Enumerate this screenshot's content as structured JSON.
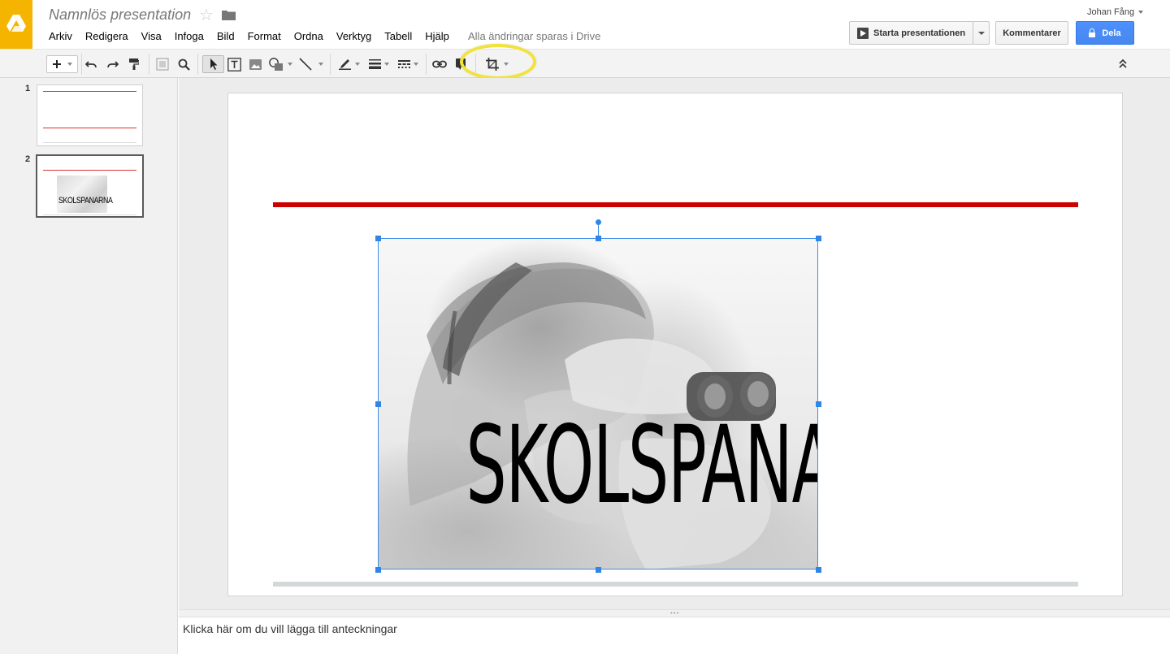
{
  "app": {
    "doc_title": "Namnlös presentation",
    "save_status": "Alla ändringar sparas i Drive",
    "user_name": "Johan Fång"
  },
  "menu": [
    "Arkiv",
    "Redigera",
    "Visa",
    "Infoga",
    "Bild",
    "Format",
    "Ordna",
    "Verktyg",
    "Tabell",
    "Hjälp"
  ],
  "header_buttons": {
    "present": "Starta presentationen",
    "comments": "Kommentarer",
    "share": "Dela"
  },
  "toolbar": {
    "icons": [
      "new-slide-icon",
      "undo-icon",
      "redo-icon",
      "paint-format-icon",
      "fit-icon",
      "zoom-icon",
      "select-icon",
      "text-box-icon",
      "image-icon",
      "shape-icon",
      "line-icon",
      "border-color-icon",
      "border-weight-icon",
      "border-dash-icon",
      "link-icon",
      "comment-icon",
      "crop-icon",
      "collapse-icon"
    ],
    "highlight_color": "#f2e33a"
  },
  "filmstrip": {
    "slides": [
      {
        "number": "1"
      },
      {
        "number": "2",
        "image_text": "SKOLSPANARNA"
      }
    ]
  },
  "slide": {
    "image_text": "SKOLSPANARNA",
    "title_line_color": "#cc0000",
    "footer_line_color": "#d3d9d9",
    "selection_color": "#3d8ce8"
  },
  "notes": {
    "placeholder": "Klicka här om du vill lägga till anteckningar"
  },
  "colors": {
    "brand": "#f4b400",
    "share_button": "#4d90fe"
  }
}
